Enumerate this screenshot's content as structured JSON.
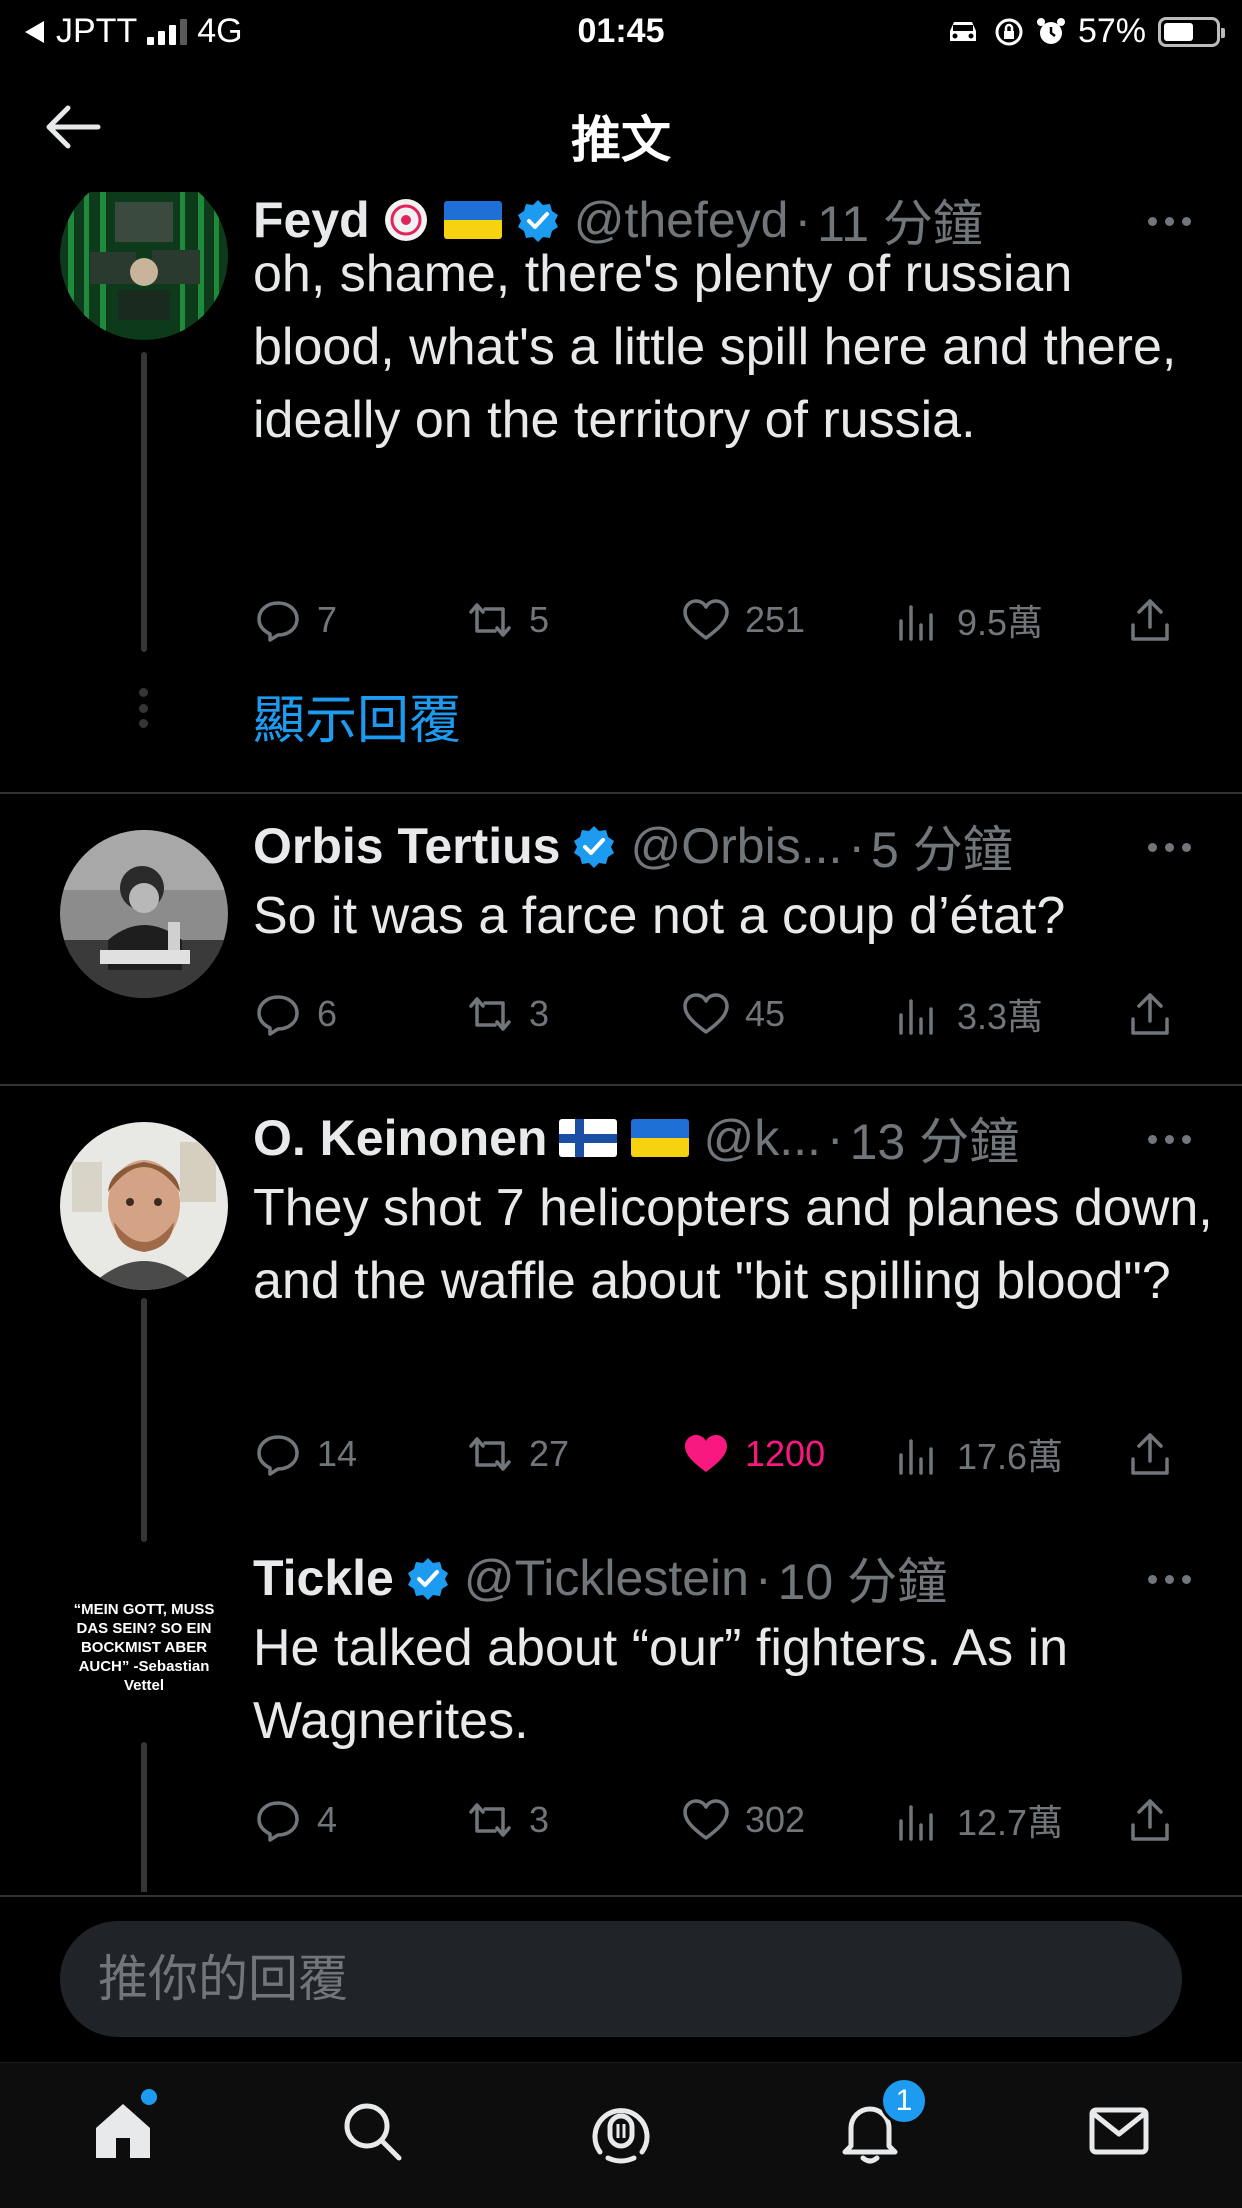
{
  "status_bar": {
    "carrier": "JPTT",
    "network": "4G",
    "time": "01:45",
    "battery": "57%",
    "battery_level": 0.57
  },
  "header": {
    "title": "推文"
  },
  "tweets": [
    {
      "name": "Feyd",
      "handle": "@thefeyd",
      "time": "11 分鐘",
      "text": "oh, shame, there's plenty of russian blood, what's a little spill here and there, ideally on the territory of russia.",
      "replies": "7",
      "retweets": "5",
      "likes": "251",
      "views": "9.5萬",
      "show_replies": "顯示回覆"
    },
    {
      "name": "Orbis Tertius",
      "handle": "@Orbis...",
      "time": "5 分鐘",
      "text": "So it was a farce not a coup d’état?",
      "replies": "6",
      "retweets": "3",
      "likes": "45",
      "views": "3.3萬"
    },
    {
      "name": "O. Keinonen",
      "handle": "@k...",
      "time": "13 分鐘",
      "text": "They shot 7 helicopters and planes down, and the waffle about \"bit spilling blood\"?",
      "replies": "14",
      "retweets": "27",
      "likes": "1200",
      "views": "17.6萬",
      "liked": true
    },
    {
      "name": "Tickle",
      "handle": "@Ticklestein",
      "time": "10 分鐘",
      "text": "He talked about “our” fighters. As in Wagnerites.",
      "replies": "4",
      "retweets": "3",
      "likes": "302",
      "views": "12.7萬",
      "avatar_text": "“MEIN GOTT, MUSS DAS SEIN? SO EIN BOCKMIST ABER AUCH” -Sebastian Vettel"
    }
  ],
  "reply_box": {
    "placeholder": "推你的回覆"
  },
  "tabbar": {
    "items": [
      "home-icon",
      "search-icon",
      "spaces-icon",
      "bell-icon",
      "mail-icon"
    ],
    "notifications_count": "1"
  },
  "colors": {
    "accent": "#1d9bf0",
    "like": "#f91880",
    "muted": "#71767b",
    "background": "#000000"
  }
}
